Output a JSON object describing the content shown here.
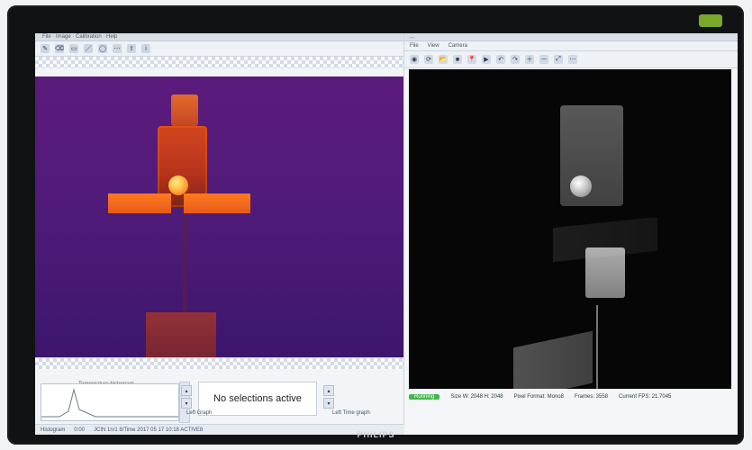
{
  "left_window": {
    "title": "File · Image · Calibration · Help",
    "toolbar_icons": [
      "pencil-icon",
      "eraser-icon",
      "select-icon",
      "line-icon",
      "shape-icon",
      "more-icon",
      "export-icon",
      "info-icon"
    ],
    "bottom": {
      "histogram_title": "Temperature histogram",
      "no_selection": "No selections active",
      "graph_left": "Left Graph",
      "graph_right": "Left Time graph"
    },
    "status": [
      "Histogram",
      "0:00",
      "JCIN 1n/1 8/Time 2017 05 17 10:18 ACTIVE8"
    ]
  },
  "right_window": {
    "title": "...",
    "menu": [
      "File",
      "View",
      "Camera"
    ],
    "toolbar_icons": [
      "record-icon",
      "refresh-icon",
      "open-icon",
      "stop-icon",
      "pin-icon",
      "play-icon",
      "undo-icon",
      "redo-icon",
      "zoom-in-icon",
      "zoom-out-icon",
      "zoom-fit-icon",
      "more-icon"
    ],
    "status": {
      "state": "Running",
      "size": "Size W: 2048  H: 2048",
      "pixel": "Pixel Format: Mono8",
      "frames": "Frames: 3558",
      "fps": "Current FPS: 21.7045"
    }
  },
  "monitor": {
    "brand": "PHILIPS"
  }
}
